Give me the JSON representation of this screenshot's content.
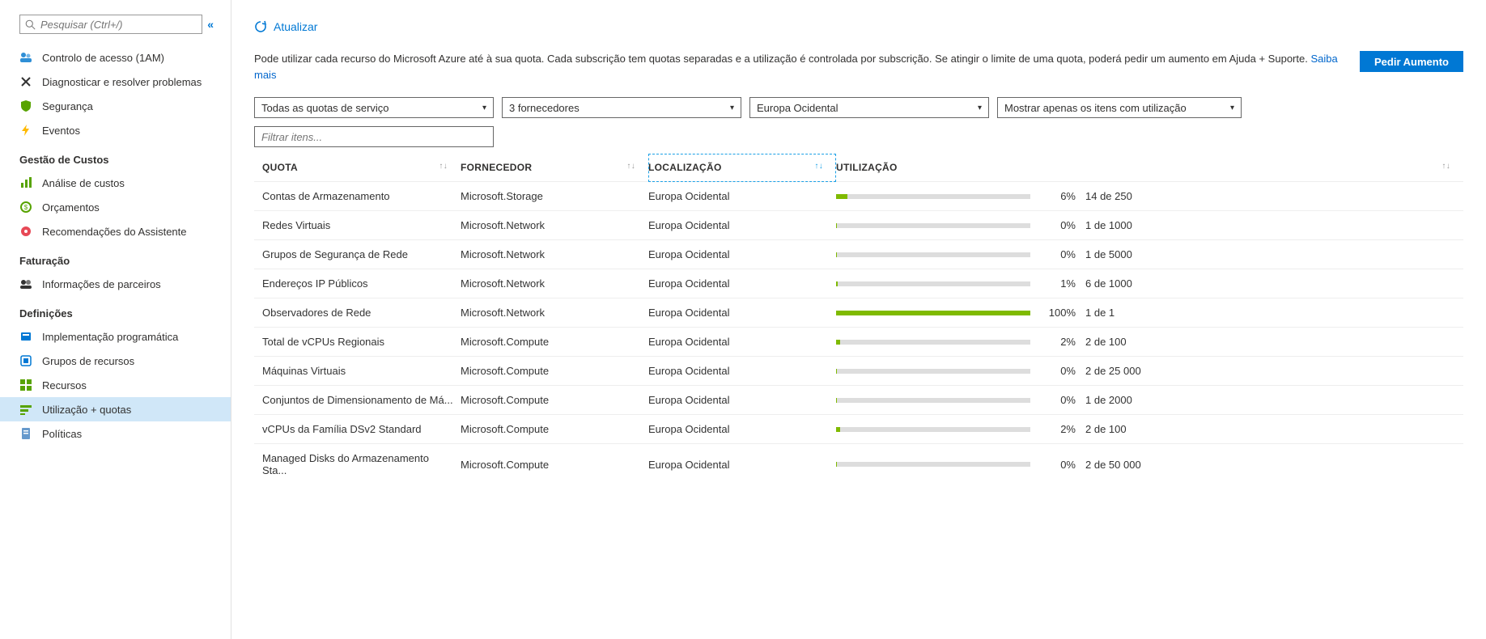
{
  "sidebar": {
    "search_placeholder": "Pesquisar (Ctrl+/)",
    "items_top": [
      {
        "label": "Controlo de acesso (1AM)",
        "icon": "people"
      },
      {
        "label": "Diagnosticar e resolver problemas",
        "icon": "tools"
      },
      {
        "label": "Segurança",
        "icon": "shield"
      },
      {
        "label": "Eventos",
        "icon": "bolt"
      }
    ],
    "section_costs": "Gestão de Custos",
    "items_costs": [
      {
        "label": "Análise de custos",
        "icon": "analysis"
      },
      {
        "label": "Orçamentos",
        "icon": "budget"
      },
      {
        "label": "Recomendações do Assistente",
        "icon": "advisor"
      }
    ],
    "section_billing": "Faturação",
    "items_billing": [
      {
        "label": "Informações de parceiros",
        "icon": "partner"
      }
    ],
    "section_settings": "Definições",
    "items_settings": [
      {
        "label": "Implementação programática",
        "icon": "deploy"
      },
      {
        "label": "Grupos de recursos",
        "icon": "rg"
      },
      {
        "label": "Recursos",
        "icon": "grid"
      },
      {
        "label": "Utilização + quotas",
        "icon": "quota",
        "active": true
      },
      {
        "label": "Políticas",
        "icon": "policy"
      }
    ]
  },
  "toolbar": {
    "refresh": "Atualizar"
  },
  "intro": {
    "text": "Pode utilizar cada recurso do Microsoft Azure até à sua quota. Cada subscrição tem quotas separadas e a utilização é controlada por subscrição. Se atingir o limite de uma quota, poderá pedir um aumento em Ajuda + Suporte. ",
    "link": "Saiba mais"
  },
  "request_button": "Pedir Aumento",
  "filters": {
    "d1": "Todas as quotas de serviço",
    "d2": "3 fornecedores",
    "d3": "Europa Ocidental",
    "d4": "Mostrar apenas os itens com utilização",
    "filter_placeholder": "Filtrar itens..."
  },
  "columns": {
    "quota": "QUOTA",
    "forn": "FORNECEDOR",
    "loc": "LOCALIZAÇÃO",
    "util": "UTILIZAÇÃO"
  },
  "rows": [
    {
      "quota": "Contas de Armazenamento",
      "forn": "Microsoft.Storage",
      "loc": "Europa Ocidental",
      "pct": "6%",
      "ratio": "14 de 250",
      "fill": 6
    },
    {
      "quota": "Redes Virtuais",
      "forn": "Microsoft.Network",
      "loc": "Europa Ocidental",
      "pct": "0%",
      "ratio": "1 de 1000",
      "fill": 0.5
    },
    {
      "quota": "Grupos de Segurança de Rede",
      "forn": "Microsoft.Network",
      "loc": "Europa Ocidental",
      "pct": "0%",
      "ratio": "1 de 5000",
      "fill": 0.5
    },
    {
      "quota": "Endereços IP Públicos",
      "forn": "Microsoft.Network",
      "loc": "Europa Ocidental",
      "pct": "1%",
      "ratio": "6 de 1000",
      "fill": 1
    },
    {
      "quota": "Observadores de Rede",
      "forn": "Microsoft.Network",
      "loc": "Europa Ocidental",
      "pct": "100%",
      "ratio": "1 de 1",
      "fill": 100
    },
    {
      "quota": "Total de vCPUs Regionais",
      "forn": "Microsoft.Compute",
      "loc": "Europa Ocidental",
      "pct": "2%",
      "ratio": "2 de 100",
      "fill": 2
    },
    {
      "quota": "Máquinas Virtuais",
      "forn": "Microsoft.Compute",
      "loc": "Europa Ocidental",
      "pct": "0%",
      "ratio": "2 de 25 000",
      "fill": 0.5
    },
    {
      "quota": "Conjuntos de Dimensionamento de Má...",
      "forn": "Microsoft.Compute",
      "loc": "Europa Ocidental",
      "pct": "0%",
      "ratio": "1 de 2000",
      "fill": 0.5
    },
    {
      "quota": "vCPUs da Família DSv2 Standard",
      "forn": "Microsoft.Compute",
      "loc": "Europa Ocidental",
      "pct": "2%",
      "ratio": "2 de 100",
      "fill": 2
    },
    {
      "quota": "Managed Disks do Armazenamento Sta...",
      "forn": "Microsoft.Compute",
      "loc": "Europa Ocidental",
      "pct": "0%",
      "ratio": "2 de 50 000",
      "fill": 0.5
    }
  ]
}
